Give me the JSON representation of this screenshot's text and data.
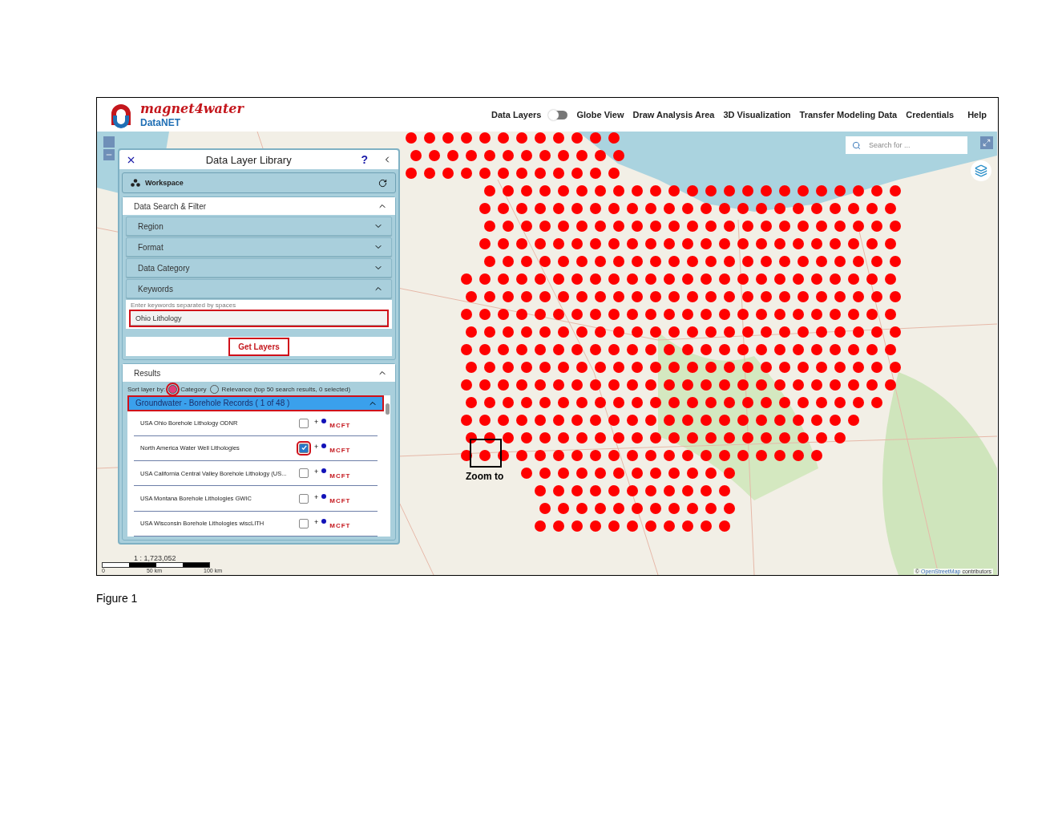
{
  "header": {
    "logo_title": "magnet4water",
    "logo_subtitle": "DataNET",
    "nav": [
      {
        "kind": "link",
        "label": "Data Layers"
      },
      {
        "kind": "toggle",
        "label": "Globe View",
        "on": false
      },
      {
        "kind": "link",
        "label": "Draw Analysis Area"
      },
      {
        "kind": "link",
        "label": "3D Visualization"
      },
      {
        "kind": "link",
        "label": "Transfer Modeling Data"
      },
      {
        "kind": "link",
        "label": "Credentials"
      },
      {
        "kind": "link",
        "label": "Help"
      }
    ]
  },
  "map": {
    "search": {
      "placeholder": "Search for ..."
    },
    "scale": {
      "ratio": "1 : 1,723,052",
      "ticks": [
        "0",
        "50 km",
        "100 km"
      ]
    },
    "attribution": {
      "symbol": "©",
      "link": "OpenStreetMap",
      "text": "contributors"
    },
    "annotation": "Zoom to"
  },
  "panel": {
    "title": "Data Layer Library",
    "help": "?",
    "workspace": "Workspace",
    "search_filter": {
      "title": "Data Search & Filter",
      "expanded": true,
      "sections": [
        {
          "label": "Region",
          "expanded": false
        },
        {
          "label": "Format",
          "expanded": false
        },
        {
          "label": "Data Category",
          "expanded": false
        },
        {
          "label": "Keywords",
          "expanded": true
        }
      ],
      "keywords": {
        "hint": "Enter keywords separated by spaces",
        "value": "Ohio Lithology",
        "highlighted": true
      },
      "button": {
        "label": "Get Layers",
        "highlighted": true
      }
    },
    "results": {
      "title": "Results",
      "expanded": true,
      "sort_label": "Sort layer by:",
      "sort_options": [
        {
          "label": "Category",
          "selected": true,
          "highlighted": true
        },
        {
          "label": "Relevance (top 50 search results, 0 selected)",
          "selected": false,
          "highlighted": false
        }
      ],
      "group": {
        "label": "Groundwater - Borehole Records ( 1 of 48 )",
        "expanded": true,
        "highlighted": true
      },
      "layers": [
        {
          "name": "USA Ohio Borehole Lithology ODNR",
          "checked": false,
          "highlighted": false,
          "plus": "+",
          "tags": [
            "M",
            "C",
            "F",
            "T"
          ]
        },
        {
          "name": "North America Water Well Lithologies",
          "checked": true,
          "highlighted": true,
          "plus": "+",
          "tags": [
            "M",
            "C",
            "F",
            "T"
          ]
        },
        {
          "name": "USA California Central Valley Borehole Lithology (US...",
          "checked": false,
          "highlighted": false,
          "plus": "+",
          "tags": [
            "M",
            "C",
            "F",
            "T"
          ]
        },
        {
          "name": "USA Montana Borehole Lithologies GWIC",
          "checked": false,
          "highlighted": false,
          "plus": "+",
          "tags": [
            "M",
            "C",
            "F",
            "T"
          ]
        },
        {
          "name": "USA Wisconsin Borehole Lithologies wiscLITH",
          "checked": false,
          "highlighted": false,
          "plus": "+",
          "tags": [
            "M",
            "C",
            "F",
            "T"
          ]
        }
      ]
    }
  },
  "caption": "Figure 1"
}
